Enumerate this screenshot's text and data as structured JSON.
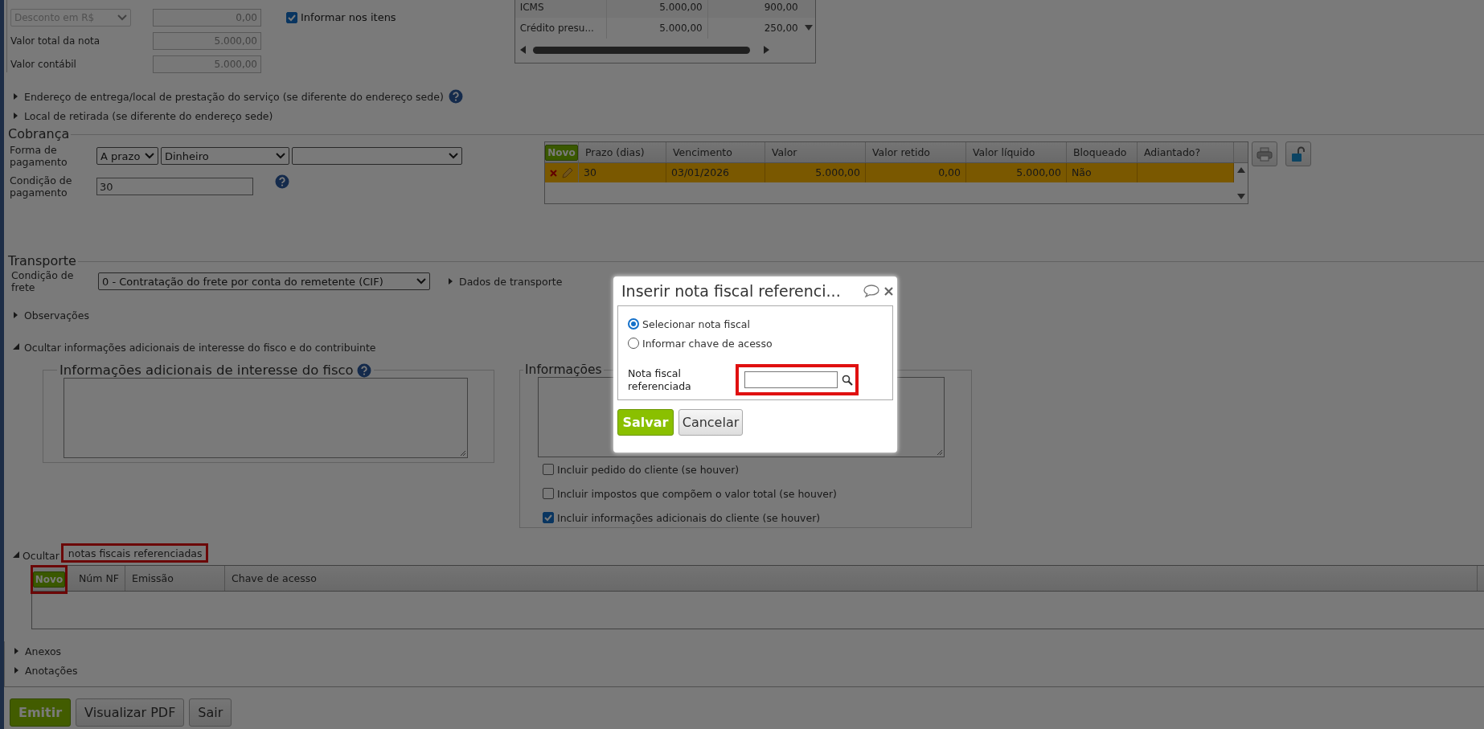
{
  "totals": {
    "discount_type": "Desconto em R$",
    "discount_value": "0,00",
    "inform_items": {
      "label": "Informar nos itens",
      "checked": true
    },
    "rows": [
      {
        "label": "Valor total da nota",
        "value": "5.000,00"
      },
      {
        "label": "Valor contábil",
        "value": "5.000,00"
      }
    ]
  },
  "tax_table": {
    "rows": [
      {
        "cells": [
          "ICMS",
          "5.000,00",
          "900,00"
        ]
      },
      {
        "cells": [
          "Crédito presu...",
          "5.000,00",
          "250,00"
        ]
      }
    ]
  },
  "address_links": [
    {
      "label": "Endereço de entrega/local de prestação do serviço (se diferente do endereço sede)",
      "expanded": false,
      "help": true
    },
    {
      "label": "Local de retirada (se diferente do endereço sede)",
      "expanded": false,
      "help": false
    }
  ],
  "cobranca": {
    "title": "Cobrança",
    "payment_form_label": "Forma de pagamento",
    "payment_term": "A prazo",
    "payment_method": "Dinheiro",
    "condition_label": "Condição de pagamento",
    "condition_value": "30",
    "installments": {
      "new_button": "Novo",
      "columns": [
        "Prazo (dias)",
        "Vencimento",
        "Valor",
        "Valor retido",
        "Valor líquido",
        "Bloqueado",
        "Adiantado?"
      ],
      "rows": [
        {
          "cells": [
            "30",
            "03/01/2026",
            "5.000,00",
            "0,00",
            "5.000,00",
            "Não",
            ""
          ],
          "selected": true
        }
      ]
    }
  },
  "transporte": {
    "title": "Transporte",
    "freight_label": "Condição de frete",
    "freight_value": "0 - Contratação do frete por conta do remetente (CIF)",
    "details_link": {
      "label": "Dados de transporte",
      "expanded": false
    }
  },
  "observacoes": {
    "label": "Observações",
    "expanded": false
  },
  "additional_info": {
    "label": "Ocultar informações adicionais de interesse do fisco e do contribuinte",
    "expanded": true,
    "fisco_title": "Informações adicionais de interesse do fisco",
    "contrib_title": "Informações",
    "options": [
      {
        "label": "Incluir pedido do cliente (se houver)",
        "checked": false
      },
      {
        "label": "Incluir impostos que compõem o valor total (se houver)",
        "checked": false
      },
      {
        "label": "Incluir informações adicionais do cliente (se houver)",
        "checked": true
      }
    ]
  },
  "referenced": {
    "label_start": "Ocultar",
    "label_rest": "notas fiscais referenciadas",
    "expanded": true,
    "highlighted": true,
    "new_button": {
      "label": "Novo",
      "highlighted": true
    },
    "columns": [
      "Núm NF",
      "Emissão",
      "Chave de acesso"
    ]
  },
  "sub_sections": [
    {
      "label": "Anexos",
      "expanded": false
    },
    {
      "label": "Anotações",
      "expanded": false
    }
  ],
  "footer_buttons": [
    {
      "label": "Emitir",
      "kind": "primary"
    },
    {
      "label": "Visualizar PDF",
      "kind": "default"
    },
    {
      "label": "Sair",
      "kind": "default"
    }
  ],
  "dialog": {
    "title": "Inserir nota fiscal referenci...",
    "options": [
      {
        "label": "Selecionar nota fiscal",
        "selected": true
      },
      {
        "label": "Informar chave de acesso",
        "selected": false
      }
    ],
    "field_label": "Nota fiscal referenciada",
    "field_highlighted": true,
    "buttons": [
      {
        "label": "Salvar",
        "kind": "primary"
      },
      {
        "label": "Cancelar",
        "kind": "default"
      }
    ]
  }
}
